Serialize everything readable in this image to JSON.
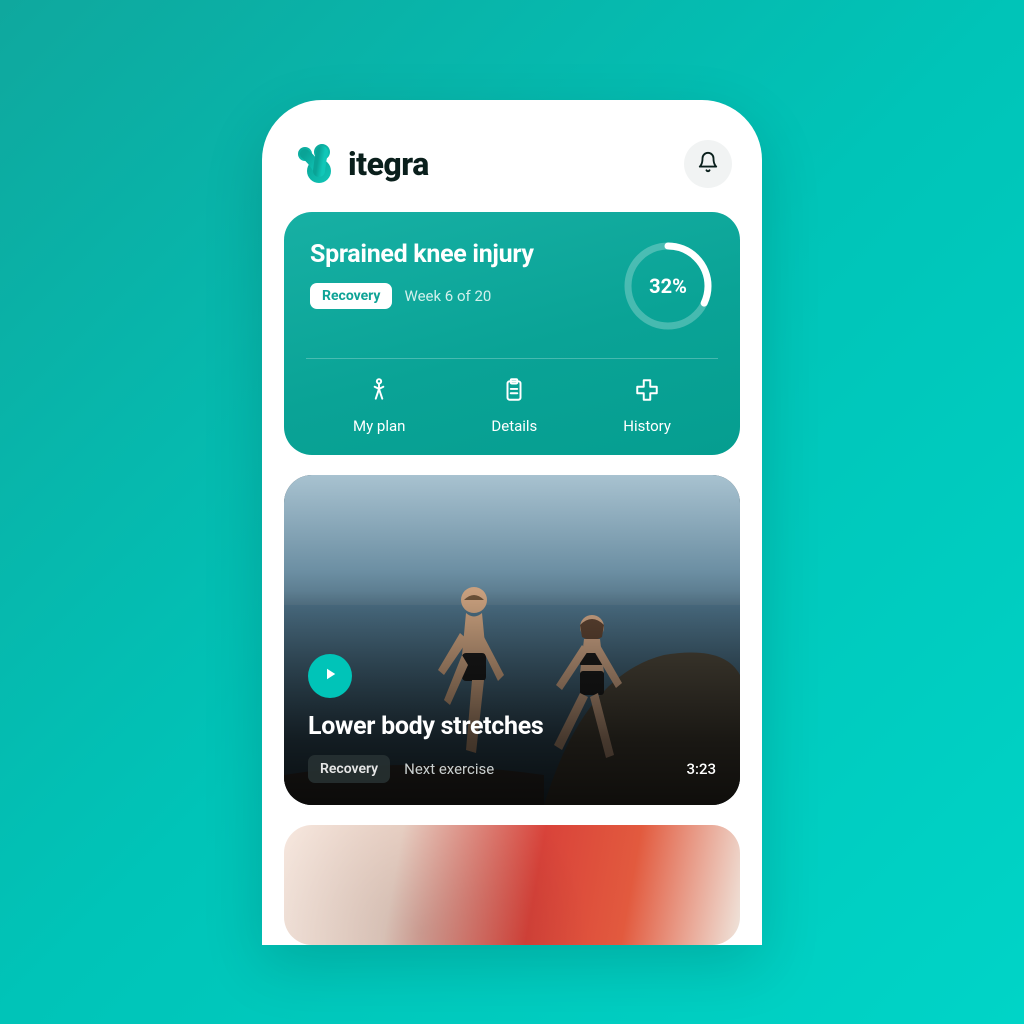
{
  "header": {
    "brand": "itegra"
  },
  "injury_card": {
    "title": "Sprained knee injury",
    "badge": "Recovery",
    "week_text": "Week 6 of 20",
    "progress_label": "32%",
    "progress_value": 32,
    "tabs": {
      "plan": "My plan",
      "details": "Details",
      "history": "History"
    }
  },
  "video": {
    "title": "Lower body stretches",
    "badge": "Recovery",
    "meta": "Next exercise",
    "duration": "3:23"
  }
}
